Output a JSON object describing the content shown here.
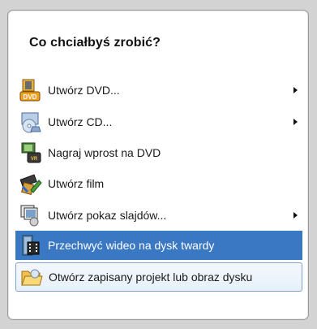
{
  "menu": {
    "heading": "Co chciałbyś zrobić?",
    "items": [
      {
        "label": "Utwórz DVD...",
        "icon": "dvd-create-icon",
        "has_submenu": true
      },
      {
        "label": "Utwórz CD...",
        "icon": "cd-create-icon",
        "has_submenu": true
      },
      {
        "label": "Nagraj wprost na DVD",
        "icon": "record-to-dvd-icon",
        "has_submenu": false
      },
      {
        "label": "Utwórz film",
        "icon": "film-create-icon",
        "has_submenu": false
      },
      {
        "label": "Utwórz pokaz slajdów...",
        "icon": "slideshow-icon",
        "has_submenu": true
      },
      {
        "label": "Przechwyć wideo na dysk twardy",
        "icon": "capture-video-icon",
        "has_submenu": false,
        "state": "selected"
      },
      {
        "label": "Otwórz zapisany projekt lub obraz dysku",
        "icon": "open-folder-icon",
        "has_submenu": false,
        "state": "hovered"
      }
    ]
  },
  "colors": {
    "selected_bg": "#3a78c4",
    "hover_border": "#7da2ce",
    "background": "#d3d3d3"
  }
}
